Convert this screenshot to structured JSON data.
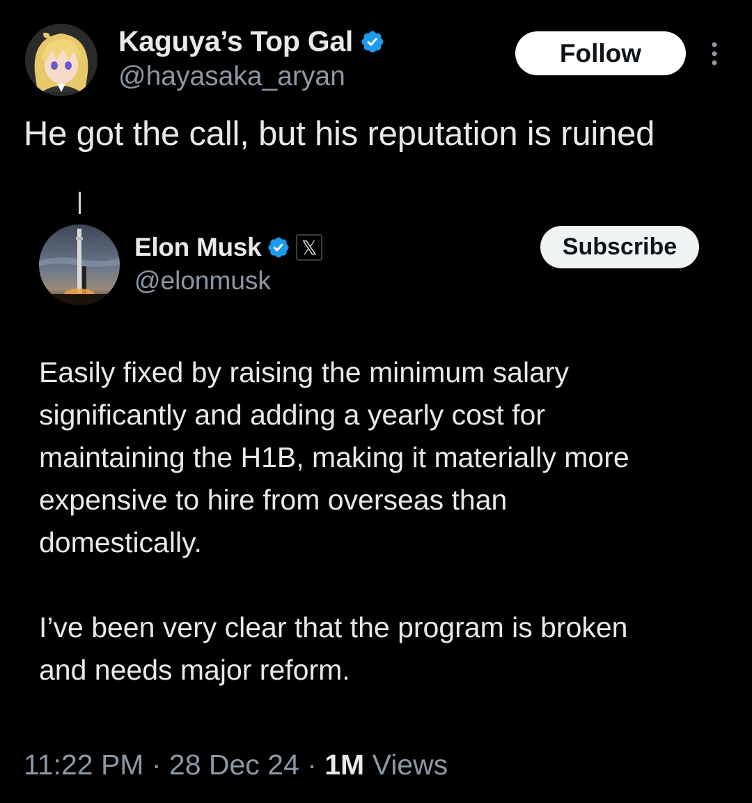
{
  "author": {
    "display_name": "Kaguya’s Top Gal",
    "handle": "@hayasaka_aryan",
    "avatar_icon": "anime-avatar-icon",
    "verified_color": "#1d9bf0"
  },
  "actions": {
    "follow_label": "Follow",
    "more_icon": "more-options-icon"
  },
  "tweet": {
    "text": "He got the call, but his reputation is ruined"
  },
  "quoted": {
    "display_name": "Elon Musk",
    "handle": "@elonmusk",
    "affiliate_badge": "𝕏",
    "subscribe_label": "Subscribe",
    "avatar_icon": "rocket-avatar-icon",
    "paragraphs": [
      "Easily fixed by raising the minimum salary\nsignificantly and adding a yearly cost for\nmaintaining the H1B, making it materially more\nexpensive to hire from overseas than\ndomestically.",
      "I’ve been very clear that the program is broken\nand needs major reform."
    ]
  },
  "meta": {
    "time": "11:22 PM",
    "separator": " · ",
    "date": "28 Dec 24",
    "views_count": "1M",
    "views_label": " Views"
  },
  "colors": {
    "background": "#000000",
    "text_primary": "#e7e9ea",
    "text_secondary": "#8b98a5",
    "accent": "#1d9bf0"
  }
}
